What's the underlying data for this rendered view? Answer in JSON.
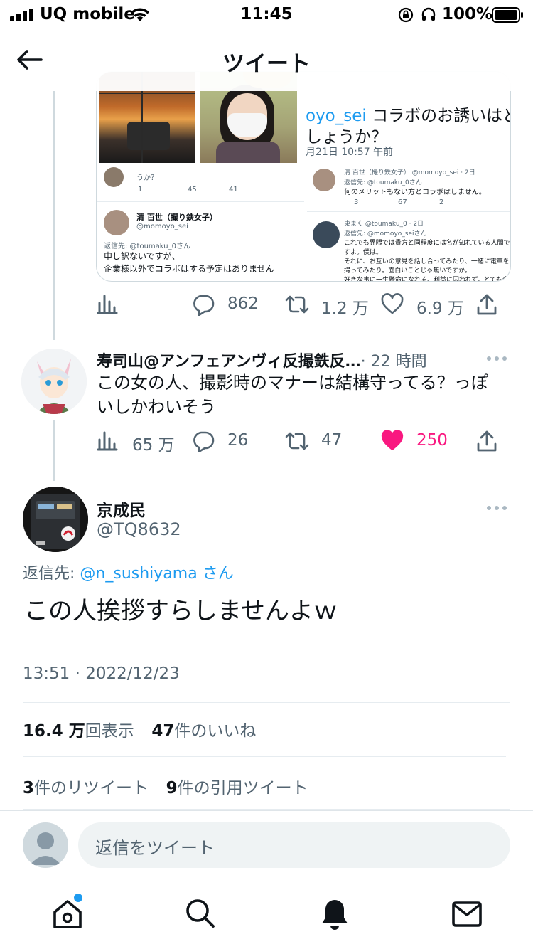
{
  "status_bar": {
    "carrier": "UQ mobile",
    "time": "11:45",
    "battery": "100%"
  },
  "header": {
    "title": "ツイート",
    "back_icon": "arrow-left-icon"
  },
  "embedded_screenshot": {
    "right_quote": {
      "handle_fragment": "oyo_sei",
      "text_line1": "コラボのお誘いはどこで",
      "text_line2": "しょうか？",
      "date": "月21日 10:57 午前"
    },
    "left_panel": {
      "prev_fragment": "うか？",
      "counts": [
        "1",
        "45",
        "41"
      ],
      "author_name": "清 百世（撮り鉄女子）",
      "author_handle": "@momoyo_sei",
      "reply_to": "返信先: @toumaku_0さん",
      "text_line1": "申し訳ないですが、",
      "text_line2": "企業様以外でコラボはする予定はありません"
    },
    "right_panel": {
      "reply1_header": "清 百世（撮り鉄女子） @momoyo_sei · 2日",
      "reply1_to": "返信先: @toumaku_0さん",
      "reply1_text": "何のメリットもない方とコラボはしません。",
      "reply1_counts": [
        "3",
        "67",
        "2"
      ],
      "reply2_header": "東まく @toumaku_0 · 2日",
      "reply2_to": "返信先: @momoyo_seiさん",
      "reply2_lines": [
        "これでも界隈では貴方と同程度には名が知れている人間で",
        "すよ。僕は。",
        "それに、お互いの意見を話し合ってみたり、一緒に電車を",
        "撮ってみたり。面白いことじゃ無いですか。",
        "好きな事に一生懸命になれる、利益に囚われず。とても素"
      ]
    }
  },
  "tweet1_actions": {
    "replies": "862",
    "retweets": "1.2 万",
    "likes": "6.9 万"
  },
  "tweet2": {
    "name": "寿司山@アンフェアンヴィ反撮鉄反…",
    "time": "· 22 時間",
    "text_line1": "この女の人、撮影時のマナーは結構守ってる？っぽ",
    "text_line2": "いしかわいそう",
    "views": "65 万",
    "replies": "26",
    "retweets": "47",
    "likes": "250"
  },
  "main_tweet": {
    "name": "京成民",
    "handle": "@TQ8632",
    "reply_prefix": "返信先:",
    "reply_user": "@n_sushiyama",
    "reply_suffix": "さん",
    "text": "この人挨拶すらしませんよｗ",
    "timestamp": "13:51 · 2022/12/23",
    "views_count": "16.4 万",
    "views_label": "回表示",
    "likes_count": "47",
    "likes_label": "件のいいね",
    "retweets_count": "3",
    "retweets_label": "件のリツイート",
    "quotes_count": "9",
    "quotes_label": "件の引用ツイート"
  },
  "reply_box": {
    "placeholder": "返信をツイート"
  },
  "tabbar": {
    "items": [
      "home-icon",
      "search-icon",
      "notifications-bell-icon",
      "messages-envelope-icon"
    ]
  },
  "colors": {
    "accent": "#1d9bf0",
    "like": "#f91880",
    "text_secondary": "#536471"
  }
}
